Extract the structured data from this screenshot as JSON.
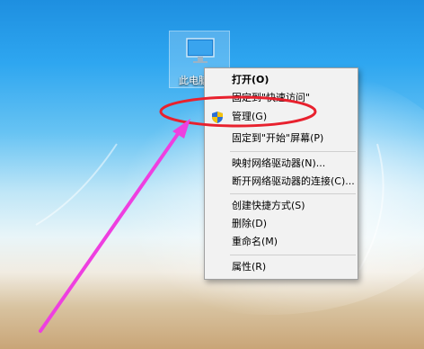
{
  "desktop": {
    "icon_label": "此电脑"
  },
  "context_menu": {
    "items": [
      {
        "label": "打开(O)",
        "bold": true
      },
      {
        "label": "固定到\"快速访问\""
      },
      {
        "label": "管理(G)",
        "icon": "uac-shield-icon"
      },
      {
        "label": "固定到\"开始\"屏幕(P)"
      },
      {
        "label": "映射网络驱动器(N)..."
      },
      {
        "label": "断开网络驱动器的连接(C)..."
      },
      {
        "label": "创建快捷方式(S)"
      },
      {
        "label": "删除(D)"
      },
      {
        "label": "重命名(M)"
      },
      {
        "label": "属性(R)"
      }
    ]
  },
  "annotation": {
    "color": "#e8212e",
    "arrow_color": "#ee3fe0"
  }
}
